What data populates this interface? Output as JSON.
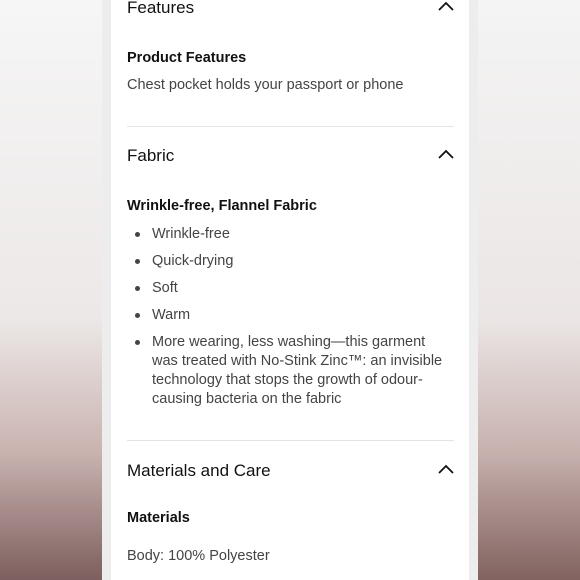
{
  "features": {
    "title": "Features",
    "subheading": "Product Features",
    "text": "Chest pocket holds your passport or phone"
  },
  "fabric": {
    "title": "Fabric",
    "subheading": "Wrinkle-free, Flannel Fabric",
    "bullets": [
      "Wrinkle-free",
      "Quick-drying",
      "Soft",
      "Warm",
      "More wearing, less washing—this garment was treated with No-Stink Zinc™: an invisible technology that stops the growth of odour-causing bacteria on the fabric"
    ]
  },
  "materials_care": {
    "title": "Materials and Care",
    "subheading": "Materials",
    "text": "Body: 100% Polyester"
  },
  "icons": {
    "collapse": "chevron-up-icon"
  }
}
